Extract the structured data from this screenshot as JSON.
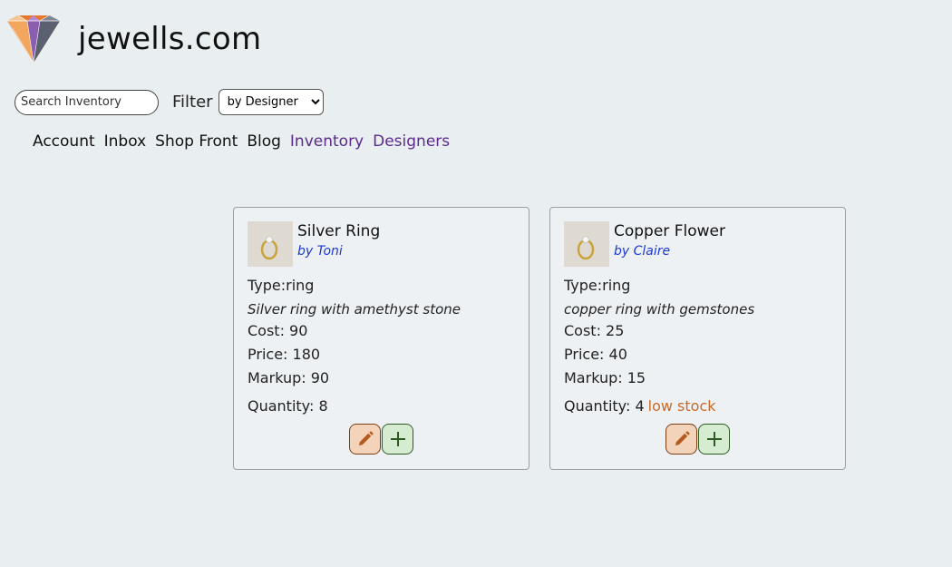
{
  "site": {
    "title": "jewells.com"
  },
  "search": {
    "placeholder": "Search Inventory",
    "value": ""
  },
  "filter": {
    "label": "Filter",
    "selected": "by Designer"
  },
  "nav": {
    "items": [
      {
        "label": "Account",
        "visited": false
      },
      {
        "label": "Inbox",
        "visited": false
      },
      {
        "label": "Shop Front",
        "visited": false
      },
      {
        "label": "Blog",
        "visited": false
      },
      {
        "label": "Inventory",
        "visited": true
      },
      {
        "label": "Designers",
        "visited": true
      }
    ]
  },
  "products": [
    {
      "name": "Silver Ring",
      "designer": "by Toni",
      "type": "Type:ring",
      "description": "Silver ring with amethyst stone",
      "cost": "Cost: 90",
      "price": "Price: 180",
      "markup": "Markup: 90",
      "quantity": "Quantity: 8",
      "stock_warning": ""
    },
    {
      "name": "Copper Flower",
      "designer": "by Claire",
      "type": "Type:ring",
      "description": "copper ring with gemstones",
      "cost": "Cost: 25",
      "price": "Price: 40",
      "markup": "Markup: 15",
      "quantity": "Quantity: 4",
      "stock_warning": "low stock"
    }
  ],
  "colors": {
    "background": "#e9eef1",
    "link_visited": "#5b2a8c",
    "designer_link": "#1a38d6",
    "low_stock": "#c96a26",
    "edit_button": "#f3d3b9",
    "add_button": "#d6ecd0"
  },
  "icons": {
    "logo": "diamond-logo",
    "edit": "pencil-icon",
    "add": "plus-icon",
    "thumbnail": "ring-thumbnail"
  }
}
